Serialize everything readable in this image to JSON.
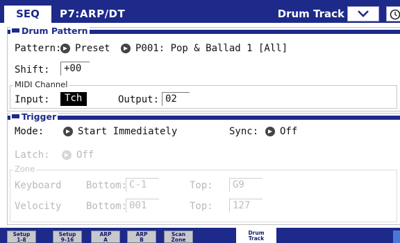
{
  "header": {
    "mode": "SEQ",
    "page": "P7:ARP/DT",
    "title": "Drum Track"
  },
  "drum_pattern": {
    "section_label": "Drum Pattern",
    "pattern_label": "Pattern:",
    "pattern_bank": "Preset",
    "pattern_value": "P001: Pop & Ballad 1 [All]",
    "shift_label": "Shift:",
    "shift_value": "+00",
    "midi_channel": {
      "label": "MIDI Channel",
      "input_label": "Input:",
      "input_value": "Tch",
      "output_label": "Output:",
      "output_value": "02"
    }
  },
  "trigger": {
    "section_label": "Trigger",
    "mode_label": "Mode:",
    "mode_value": "Start Immediately",
    "sync_label": "Sync:",
    "sync_value": "Off",
    "latch_label": "Latch:",
    "latch_value": "Off",
    "zone": {
      "label": "Zone",
      "keyboard_label": "Keyboard",
      "velocity_label": "Velocity",
      "bottom_label": "Bottom:",
      "top_label": "Top:",
      "keyboard_bottom": "C-1",
      "keyboard_top": "G9",
      "velocity_bottom": "001",
      "velocity_top": "127"
    }
  },
  "tabs": [
    {
      "line1": "Setup",
      "line2": "1-8"
    },
    {
      "line1": "Setup",
      "line2": "9-16"
    },
    {
      "line1": "ARP",
      "line2": "A"
    },
    {
      "line1": "ARP",
      "line2": "B"
    },
    {
      "line1": "Scan",
      "line2": "Zone"
    },
    {
      "line1": "Drum",
      "line2": "Track"
    }
  ],
  "icons": {
    "menu_button": "chevron-down-icon",
    "utility_button": "clock-icon",
    "popup": "arrow-right-icon"
  },
  "colors": {
    "header_blue": "#1d2a8a",
    "disabled_gray": "#b9b9b9",
    "tab_end_blue": "#4a78d8"
  }
}
